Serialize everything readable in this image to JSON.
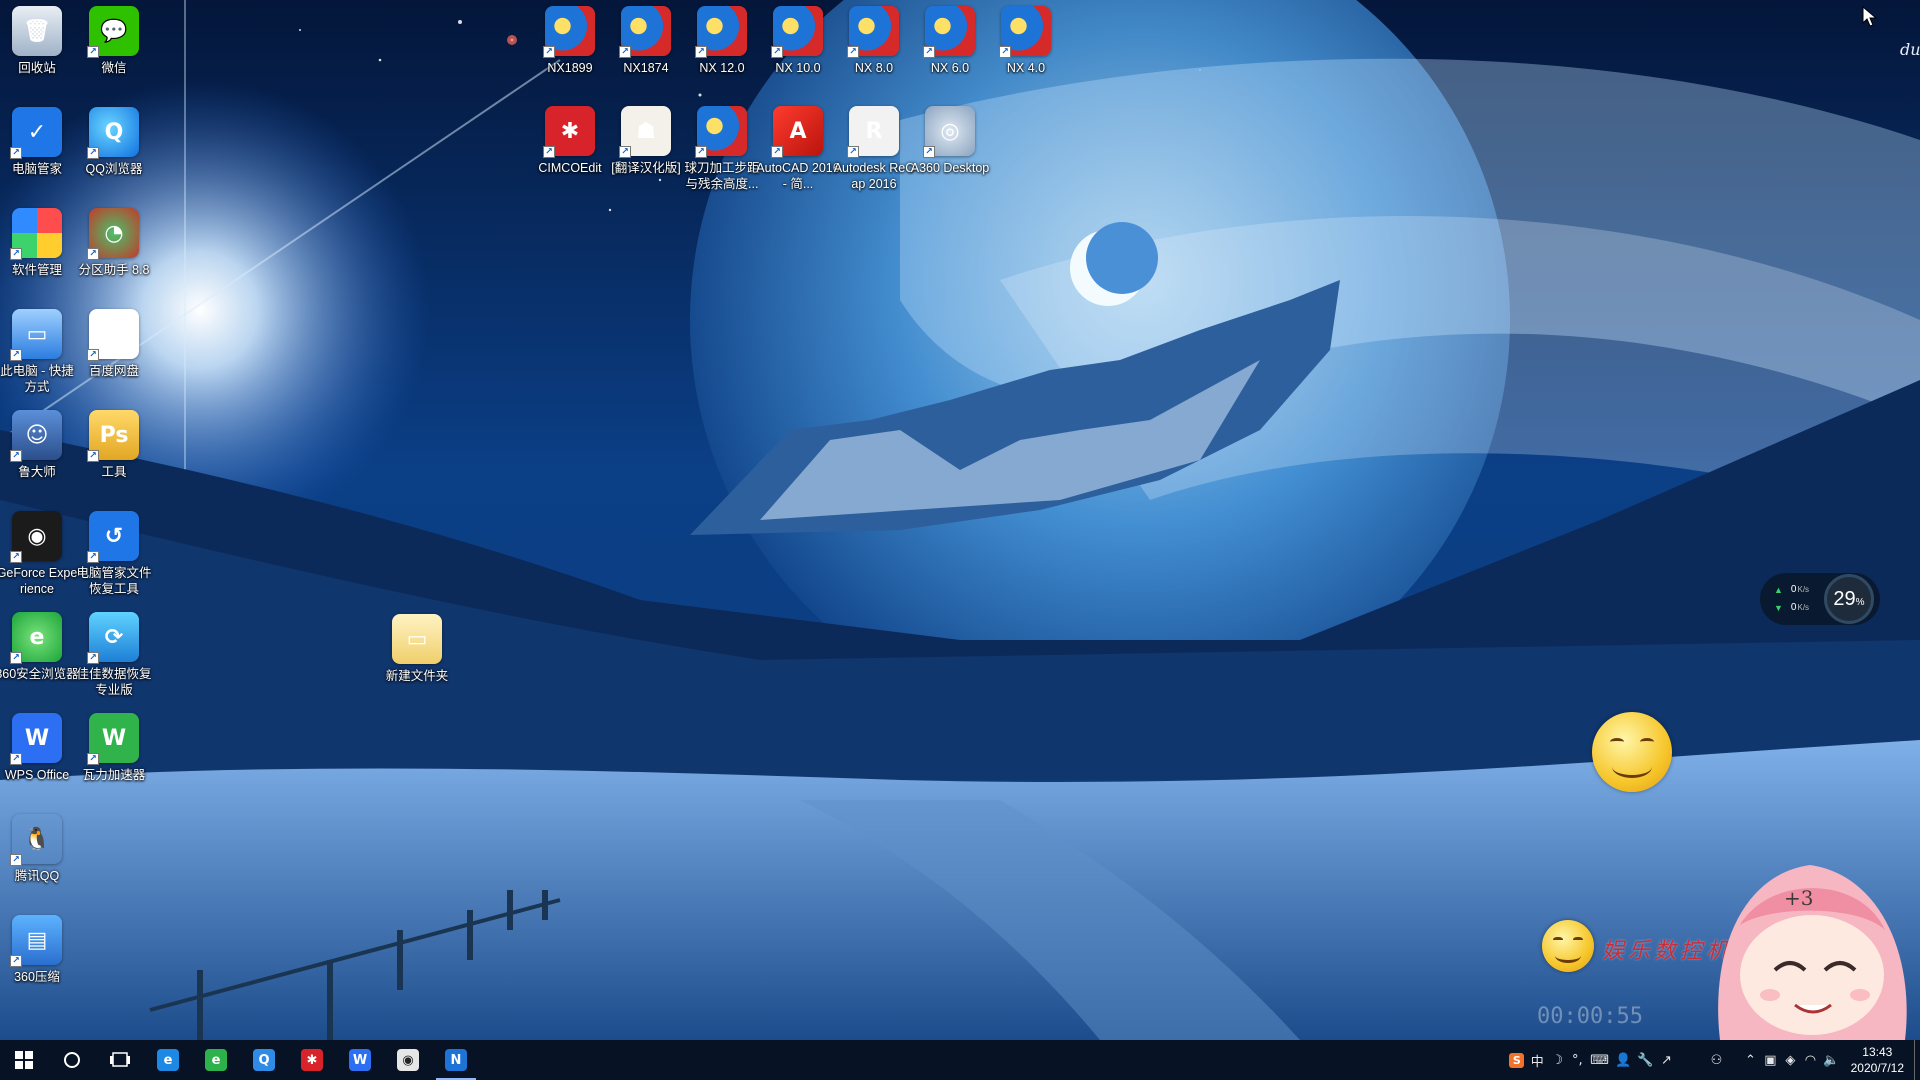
{
  "desktop": {
    "left_icons": [
      {
        "label": "回收站",
        "icon": "recycle-bin-icon",
        "glyph": "🗑"
      },
      {
        "label": "微信",
        "icon": "wechat-icon",
        "glyph": "💬"
      },
      {
        "label": "电脑管家",
        "icon": "pc-manager-shield-icon",
        "glyph": "✓"
      },
      {
        "label": "QQ浏览器",
        "icon": "qq-browser-icon",
        "glyph": "Q"
      },
      {
        "label": "软件管理",
        "icon": "software-manager-icon",
        "glyph": ""
      },
      {
        "label": "分区助手 8.8",
        "icon": "partition-assistant-icon",
        "glyph": "◔"
      },
      {
        "label": "此电脑 - 快捷方式",
        "icon": "this-pc-icon",
        "glyph": "▭"
      },
      {
        "label": "百度网盘",
        "icon": "baidu-netdisk-icon",
        "glyph": "⚭"
      },
      {
        "label": "鲁大师",
        "icon": "ludashi-icon",
        "glyph": "☺"
      },
      {
        "label": "工具",
        "icon": "tools-folder-icon",
        "glyph": "Ps"
      },
      {
        "label": "GeForce Experience",
        "icon": "geforce-icon",
        "glyph": "◉"
      },
      {
        "label": "电脑管家文件恢复工具",
        "icon": "file-recovery-icon",
        "glyph": "↺"
      },
      {
        "label": "360安全浏览器",
        "icon": "360-browser-icon",
        "glyph": "e"
      },
      {
        "label": "佳佳数据恢复专业版",
        "icon": "jiajia-recovery-icon",
        "glyph": "⟳"
      },
      {
        "label": "WPS Office",
        "icon": "wps-office-icon",
        "glyph": "W"
      },
      {
        "label": "瓦力加速器",
        "icon": "wali-accelerator-icon",
        "glyph": "W"
      },
      {
        "label": "腾讯QQ",
        "icon": "tencent-qq-penguin-icon",
        "glyph": "🐧"
      },
      {
        "label": "360压缩",
        "icon": "360-zip-icon",
        "glyph": "▤"
      }
    ],
    "top_row_1": [
      {
        "label": "NX1899",
        "icon": "nx-icon"
      },
      {
        "label": "NX1874",
        "icon": "nx-icon"
      },
      {
        "label": "NX 12.0",
        "icon": "nx-icon"
      },
      {
        "label": "NX 10.0",
        "icon": "nx-icon"
      },
      {
        "label": "NX 8.0",
        "icon": "nx-icon"
      },
      {
        "label": "NX 6.0",
        "icon": "nx-icon"
      },
      {
        "label": "NX 4.0",
        "icon": "nx-icon"
      }
    ],
    "top_row_2": [
      {
        "label": "CIMCOEdit",
        "icon": "cimco-edit-icon",
        "glyph": "✱"
      },
      {
        "label": "[翻译汉化版]",
        "icon": "beijing-olympic-icon",
        "glyph": "☗"
      },
      {
        "label": "球刀加工步距与残余高度...",
        "icon": "ball-cutter-calculator-icon",
        "glyph": ""
      },
      {
        "label": "AutoCAD 2016 - 简...",
        "icon": "autocad-icon",
        "glyph": "A"
      },
      {
        "label": "Autodesk ReCap 2016",
        "icon": "autodesk-recap-icon",
        "glyph": "R"
      },
      {
        "label": "A360 Desktop",
        "icon": "a360-desktop-icon",
        "glyph": "◎"
      }
    ],
    "folder": {
      "label": "新建文件夹",
      "icon": "new-folder-icon"
    }
  },
  "widgets": {
    "net_up": "0",
    "net_down": "0",
    "net_unit": "K/s",
    "cpu_value": "29",
    "cpu_unit": "%",
    "plus_three": "+3",
    "watermark": "娱乐数控机械工程师",
    "recording_time": "00:00:55",
    "corner_text": "du"
  },
  "taskbar": {
    "apps": [
      {
        "name": "edge",
        "icon": "edge-icon",
        "glyph": "e",
        "color": "#1e88e5"
      },
      {
        "name": "360",
        "icon": "360-browser-taskbar-icon",
        "glyph": "e",
        "color": "#2db14a"
      },
      {
        "name": "qq-browser",
        "icon": "qq-browser-taskbar-icon",
        "glyph": "Q",
        "color": "#2f8be6"
      },
      {
        "name": "cimco",
        "icon": "cimco-taskbar-icon",
        "glyph": "✱",
        "color": "#d8232a"
      },
      {
        "name": "wps",
        "icon": "wps-taskbar-icon",
        "glyph": "W",
        "color": "#2d6ff2"
      },
      {
        "name": "recorder",
        "icon": "screen-recorder-icon",
        "glyph": "◉",
        "color": "#e6e6e6"
      },
      {
        "name": "nx",
        "icon": "nx-taskbar-icon",
        "glyph": "N",
        "color": "#1d73d6"
      }
    ],
    "tray": {
      "ime_lang": "中",
      "ime_punct": "°,",
      "time": "13:43",
      "date": "2020/7/12"
    }
  },
  "colors": {
    "taskbar_bg": "#081222",
    "accent": "#8fb8ff",
    "watermark": "#d8282f"
  }
}
